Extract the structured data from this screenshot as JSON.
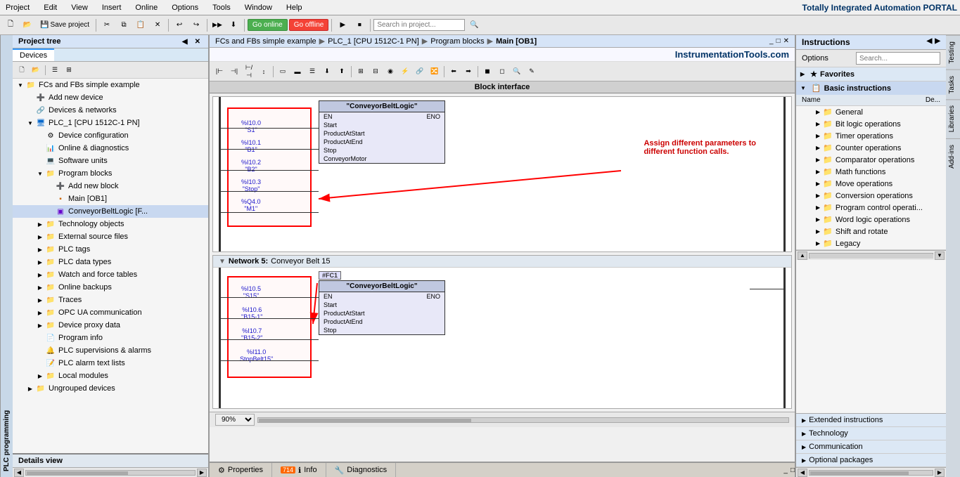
{
  "app": {
    "title": "Totally Integrated Automation PORTAL"
  },
  "menu": {
    "items": [
      "Project",
      "Edit",
      "View",
      "Insert",
      "Online",
      "Options",
      "Tools",
      "Window",
      "Help"
    ]
  },
  "toolbar": {
    "save_label": "Save project",
    "go_online": "Go online",
    "go_offline": "Go offline",
    "search_placeholder": "Search in project..."
  },
  "project_tree": {
    "title": "Project tree",
    "tabs": [
      "Devices"
    ],
    "items": [
      {
        "label": "FCs and FBs simple example",
        "level": 0,
        "type": "project",
        "expanded": true
      },
      {
        "label": "Add new device",
        "level": 1,
        "type": "add"
      },
      {
        "label": "Devices & networks",
        "level": 1,
        "type": "network"
      },
      {
        "label": "PLC_1 [CPU 1512C-1 PN]",
        "level": 1,
        "type": "cpu",
        "expanded": true
      },
      {
        "label": "Device configuration",
        "level": 2,
        "type": "device"
      },
      {
        "label": "Online & diagnostics",
        "level": 2,
        "type": "diag"
      },
      {
        "label": "Software units",
        "level": 2,
        "type": "software"
      },
      {
        "label": "Program blocks",
        "level": 2,
        "type": "folder",
        "expanded": true
      },
      {
        "label": "Add new block",
        "level": 3,
        "type": "add"
      },
      {
        "label": "Main [OB1]",
        "level": 3,
        "type": "block"
      },
      {
        "label": "ConveyorBeltLogic [F...",
        "level": 3,
        "type": "fb"
      },
      {
        "label": "Technology objects",
        "level": 2,
        "type": "folder"
      },
      {
        "label": "External source files",
        "level": 2,
        "type": "folder"
      },
      {
        "label": "PLC tags",
        "level": 2,
        "type": "folder"
      },
      {
        "label": "PLC data types",
        "level": 2,
        "type": "folder"
      },
      {
        "label": "Watch and force tables",
        "level": 2,
        "type": "folder"
      },
      {
        "label": "Online backups",
        "level": 2,
        "type": "folder"
      },
      {
        "label": "Traces",
        "level": 2,
        "type": "folder"
      },
      {
        "label": "OPC UA communication",
        "level": 2,
        "type": "folder"
      },
      {
        "label": "Device proxy data",
        "level": 2,
        "type": "folder"
      },
      {
        "label": "Program info",
        "level": 2,
        "type": "info"
      },
      {
        "label": "PLC supervisions & alarms",
        "level": 2,
        "type": "alarms"
      },
      {
        "label": "PLC alarm text lists",
        "level": 2,
        "type": "alarms"
      },
      {
        "label": "Local modules",
        "level": 2,
        "type": "folder"
      },
      {
        "label": "Ungrouped devices",
        "level": 1,
        "type": "folder"
      }
    ]
  },
  "breadcrumb": {
    "parts": [
      "FCs and FBs simple example",
      "PLC_1 [CPU 1512C-1 PN]",
      "Program blocks",
      "Main [OB1]"
    ]
  },
  "editor": {
    "block_interface_label": "Block interface",
    "website": "InstrumentationTools.com",
    "networks": [
      {
        "id": "5",
        "title": "Network 5:",
        "subtitle": "Conveyor Belt 15",
        "fb_name": "\"ConveyorBeltLogic\"",
        "fc_label": "#FC1",
        "signals": [
          {
            "addr": "%I10.5",
            "tag": "\"S15\"",
            "pin": "Start"
          },
          {
            "addr": "%I10.6",
            "tag": "\"B15-1\"",
            "pin": "ProductAtStart"
          },
          {
            "addr": "%I10.7",
            "tag": "\"B15-2\"",
            "pin": "ProductAtEnd"
          },
          {
            "addr": "%I11.0",
            "tag": "StopBelt15\"",
            "pin": "Stop"
          }
        ]
      }
    ],
    "network4": {
      "fb_name": "\"ConveyorBeltLogic\"",
      "signals": [
        {
          "addr": "%I10.0",
          "tag": "\"S1\"",
          "pin": "Start"
        },
        {
          "addr": "%I10.1",
          "tag": "\"B1\"",
          "pin": "ProductAtStart"
        },
        {
          "addr": "%I10.2",
          "tag": "\"B2\"",
          "pin": "ProductAtEnd"
        },
        {
          "addr": "%I10.3",
          "tag": "\"Stop\"",
          "pin": "Stop"
        },
        {
          "addr": "%Q4.0",
          "tag": "\"M1\"",
          "pin": "ConveyorMotor"
        }
      ]
    },
    "annotation": "Assign different parameters to\ndifferent function calls.",
    "zoom": "90%"
  },
  "instructions": {
    "panel_title": "Instructions",
    "options_label": "Options",
    "sections": {
      "favorites": {
        "label": "Favorites",
        "expanded": false
      },
      "basic": {
        "label": "Basic instructions",
        "expanded": true,
        "col_name": "Name",
        "col_desc": "De...",
        "items": [
          {
            "label": "General",
            "icon": "folder"
          },
          {
            "label": "Bit logic operations",
            "icon": "folder"
          },
          {
            "label": "Timer operations",
            "icon": "folder"
          },
          {
            "label": "Counter operations",
            "icon": "folder"
          },
          {
            "label": "Comparator operations",
            "icon": "folder"
          },
          {
            "label": "Math functions",
            "icon": "folder"
          },
          {
            "label": "Move operations",
            "icon": "folder"
          },
          {
            "label": "Conversion operations",
            "icon": "folder"
          },
          {
            "label": "Program control operati...",
            "icon": "folder"
          },
          {
            "label": "Word logic operations",
            "icon": "folder"
          },
          {
            "label": "Shift and rotate",
            "icon": "folder"
          },
          {
            "label": "Legacy",
            "icon": "folder"
          }
        ]
      },
      "extended": {
        "label": "Extended instructions",
        "expanded": false
      },
      "technology": {
        "label": "Technology",
        "expanded": false
      },
      "communication": {
        "label": "Communication",
        "expanded": false
      },
      "optional": {
        "label": "Optional packages",
        "expanded": false
      }
    }
  },
  "right_tabs": [
    "Testing",
    "Tasks",
    "Libraries",
    "Add-ins"
  ],
  "bottom_info": {
    "tabs": [
      {
        "label": "Properties",
        "icon": "⚙"
      },
      {
        "label": "Info",
        "icon": "ℹ",
        "badge": "714"
      },
      {
        "label": "Diagnostics",
        "icon": "🔧"
      }
    ]
  },
  "details": {
    "label": "Details view"
  },
  "plc_tab": "PLC programming"
}
